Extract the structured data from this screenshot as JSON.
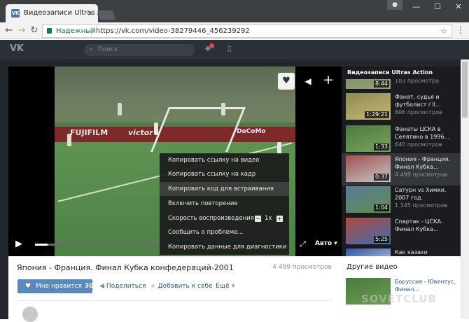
{
  "browser": {
    "tab_title": "Видеозаписи Ultras Action",
    "tab_favicon": "VK",
    "tab_close": "×",
    "user_icon": "user-icon",
    "window_buttons": [
      "—",
      "☐",
      "✕"
    ],
    "secure_label": "Надежный",
    "url": "https://vk.com/video-38279446_456239292",
    "back_glyph": "←",
    "forward_glyph": "→",
    "reload_glyph": "C",
    "star_glyph": "☆",
    "menu_glyph": "⋮"
  },
  "vk_header": {
    "logo": "VK",
    "search_placeholder": "Поиск",
    "search_glyph": "⌕",
    "bell_glyph": "🔔",
    "music_glyph": "♫"
  },
  "player": {
    "heart_glyph": "♥",
    "share_glyph": "📢",
    "add_glyph": "+",
    "play_glyph": "▶",
    "fullscreen_glyph": "⤢",
    "quality_label": "Авто ▾",
    "ad_texts": [
      "FUJIFILM",
      "victor",
      "DoCoMo"
    ],
    "progress_fraction": 0.05
  },
  "context_menu": {
    "items": [
      "Копировать ссылку на видео",
      "Копировать ссылку на кадр",
      "Копировать код для встраивания",
      "Включить повторение",
      "Скорость воспроизведения",
      "Сообщить о проблеме...",
      "Копировать данные для диагностики"
    ],
    "highlighted_index": 2,
    "speed_minus": "−",
    "speed_value": "1x",
    "speed_plus": "+"
  },
  "sidebar": {
    "title": "Видеозаписи Ultras Action",
    "items": [
      {
        "title": "",
        "views": "103 просмотра",
        "duration": "8:44"
      },
      {
        "title": "Фанат, судья и футболист / II...",
        "views": "806 просмотров",
        "duration": "1:29:21"
      },
      {
        "title": "Фанаты ЦСКА в Селятино в 1996...",
        "views": "640 просмотров",
        "duration": "1:33"
      },
      {
        "title": "Япония - Франция. Финал Кубка...",
        "views": "4 499 просмотров",
        "duration": "0:37"
      },
      {
        "title": "Сатурн vs Химки. 2007 год.",
        "views": "1 145 просмотров",
        "duration": "1:04"
      },
      {
        "title": "Спартак - ЦСКА. Финал Кубка...",
        "views": "",
        "duration": "5:25"
      },
      {
        "title": "Как казаки",
        "views": "",
        "duration": ""
      }
    ]
  },
  "video_info": {
    "title": "Япония - Франция. Финал Кубка конфедераций-2001",
    "views": "4 499 просмотров",
    "like_label": "Мне нравится",
    "like_count": "30",
    "share_label": "Поделиться",
    "add_label": "Добавить к себе",
    "more_label": "Ещё"
  },
  "other_videos": {
    "title": "Другие видео",
    "first_title": "Боруссия - Ювентус. Финал..."
  },
  "watermark": "SOVETCLUB"
}
